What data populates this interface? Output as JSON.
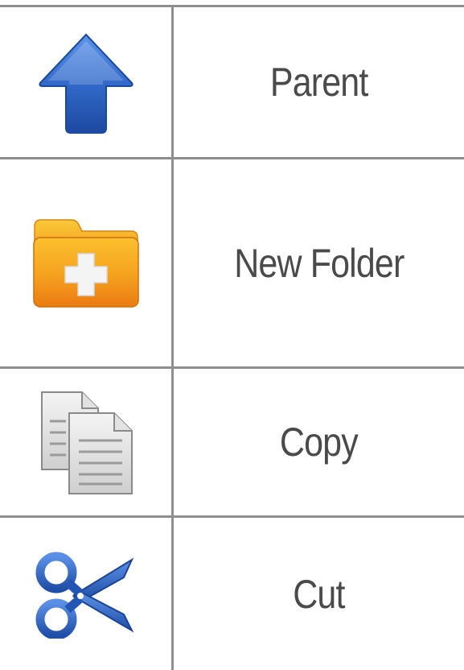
{
  "menu": {
    "items": [
      {
        "label": "Parent",
        "icon": "up-arrow-icon"
      },
      {
        "label": "New Folder",
        "icon": "new-folder-icon"
      },
      {
        "label": "Copy",
        "icon": "copy-icon"
      },
      {
        "label": "Cut",
        "icon": "scissors-icon"
      }
    ]
  },
  "colors": {
    "divider": "#8e8e8e",
    "label_text": "#4a4a4a",
    "icon_blue": "#2b63c2",
    "folder_orange": "#f0921c"
  }
}
